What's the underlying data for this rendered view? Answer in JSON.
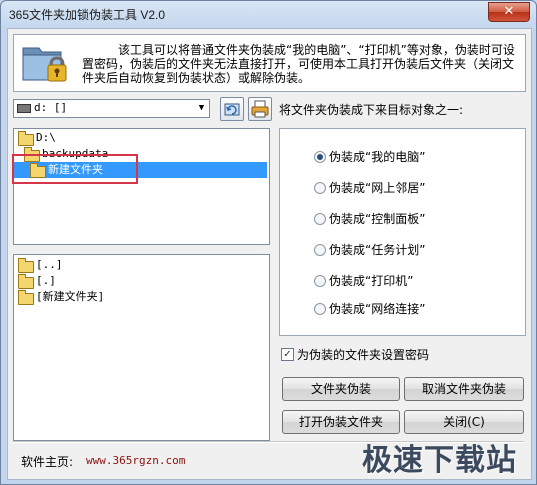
{
  "window": {
    "title": "365文件夹加锁伪装工具 V2.0",
    "close_glyph": "✕"
  },
  "info": {
    "icon": "folder-lock-icon",
    "description": "该工具可以将普通文件夹伪装成“我的电脑”、“打印机”等对象，伪装时可设置密码，伪装后的文件夹无法直接打开，可使用本工具打开伪装后文件夹（关闭文件夹后自动恢复到伪装状态）或解除伪装。"
  },
  "drive": {
    "value": "d: []",
    "arrow": "▼"
  },
  "tree": [
    {
      "label": "D:\\",
      "open": true
    },
    {
      "label": "backupdata",
      "open": true
    },
    {
      "label": "新建文件夹",
      "selected": true
    }
  ],
  "files": [
    "[..]",
    "[.]",
    "[新建文件夹]"
  ],
  "target_label": "将文件夹伪装成下来目标对象之一:",
  "radios": [
    {
      "label": "伪装成“我的电脑”",
      "checked": true
    },
    {
      "label": "伪装成“网上邻居”",
      "checked": false
    },
    {
      "label": "伪装成“控制面板”",
      "checked": false
    },
    {
      "label": "伪装成“任务计划”",
      "checked": false
    },
    {
      "label": "伪装成“打印机”",
      "checked": false
    },
    {
      "label": "伪装成“网络连接”",
      "checked": false
    }
  ],
  "password_check": {
    "label": "为伪装的文件夹设置密码",
    "checked": true,
    "mark": "✓"
  },
  "buttons": {
    "disguise": "文件夹伪装",
    "undisguise": "取消文件夹伪装",
    "open": "打开伪装文件夹",
    "close": "关闭(C)"
  },
  "footer": {
    "label": "软件主页:",
    "url": "www.365rgzn.com"
  },
  "watermark": "极速下载站",
  "colors": {
    "selection": "#3399ff",
    "highlight_box": "#d6364a",
    "url": "#8a1010"
  }
}
